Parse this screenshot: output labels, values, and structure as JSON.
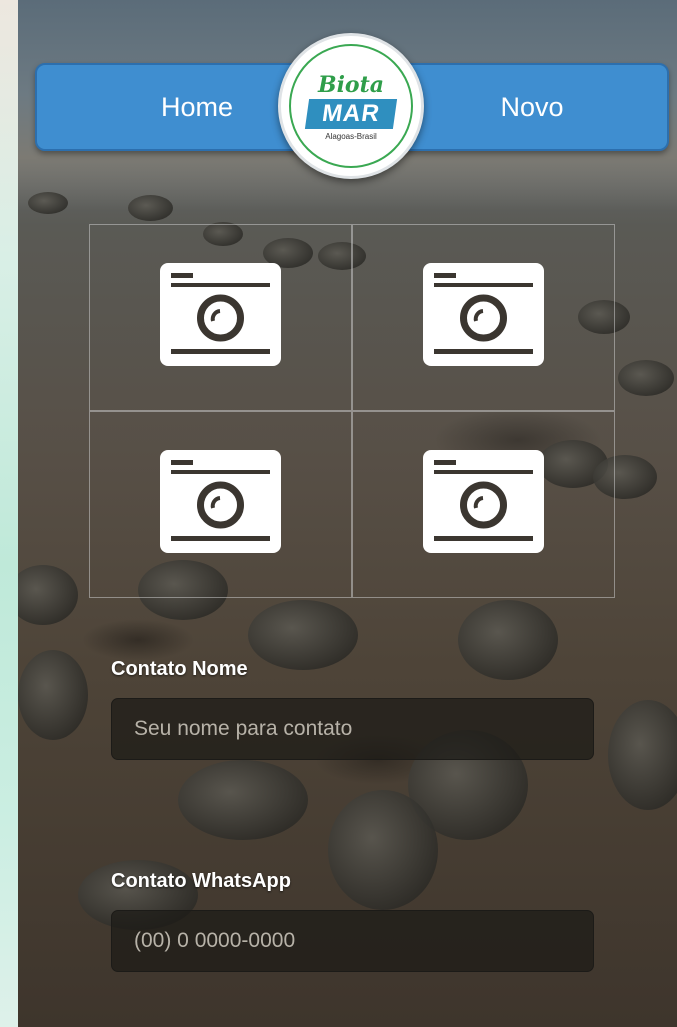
{
  "nav": {
    "home_label": "Home",
    "novo_label": "Novo",
    "accent_color": "#3f8ed0"
  },
  "logo": {
    "line1": "Biota",
    "line2": "MAR",
    "subtitle": "Alagoas-Brasil"
  },
  "photos": {
    "slots": [
      {
        "icon": "camera-icon"
      },
      {
        "icon": "camera-icon"
      },
      {
        "icon": "camera-icon"
      },
      {
        "icon": "camera-icon"
      }
    ]
  },
  "form": {
    "contact_name": {
      "label": "Contato Nome",
      "placeholder": "Seu nome para contato",
      "value": ""
    },
    "contact_whatsapp": {
      "label": "Contato WhatsApp",
      "placeholder": "(00) 0 0000-0000",
      "value": ""
    }
  }
}
